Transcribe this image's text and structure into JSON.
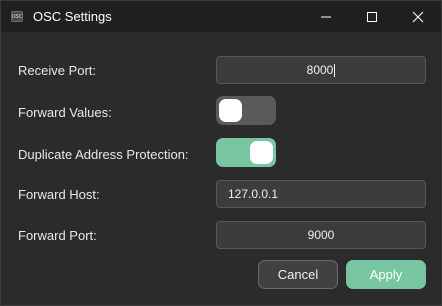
{
  "window": {
    "title": "OSC Settings",
    "app_icon_text": "OSC"
  },
  "form": {
    "receive_port": {
      "label": "Receive Port:",
      "value": "8000"
    },
    "forward_values": {
      "label": "Forward Values:",
      "on": false
    },
    "duplicate_protection": {
      "label": "Duplicate Address Protection:",
      "on": true
    },
    "forward_host": {
      "label": "Forward Host:",
      "value": "127.0.0.1"
    },
    "forward_port": {
      "label": "Forward Port:",
      "value": "9000"
    }
  },
  "buttons": {
    "cancel": "Cancel",
    "apply": "Apply"
  },
  "colors": {
    "accent": "#77c6a1",
    "background": "#2b2b2b",
    "titlebar": "#202020"
  }
}
